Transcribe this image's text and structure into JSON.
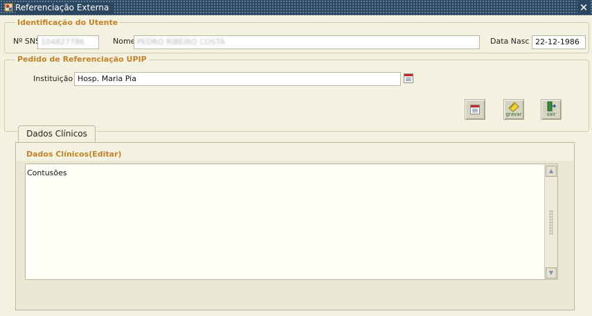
{
  "window": {
    "title": "Referenciação Externa",
    "close_glyph": "✕",
    "icon": "app-icon"
  },
  "identificacao": {
    "legend": "Identificação do Utente",
    "sns_label": "Nº SNS",
    "sns_value": "104827786",
    "nome_label": "Nome",
    "nome_value": "PEDRO RIBEIRO COSTA",
    "nasc_label": "Data Nasc",
    "nasc_value": "22-12-1986"
  },
  "pedido": {
    "legend": "Pedido de Referenciação UPIP",
    "instituicao_label": "Instituição",
    "instituicao_value": "Hosp. Maria Pia",
    "lov_icon": "list-values-icon"
  },
  "toolbar": {
    "list_icon": "list-values-icon",
    "gravar_label": "gravar",
    "sair_label": "sair"
  },
  "tabs": [
    {
      "label": "Dados Clínicos",
      "selected": true
    }
  ],
  "dados_clinicos": {
    "title": "Dados Clínicos(Editar)",
    "text": "Contusões"
  },
  "colors": {
    "legend": "#c2822a",
    "titlebar": "#2a4660",
    "background": "#f3f1df"
  }
}
